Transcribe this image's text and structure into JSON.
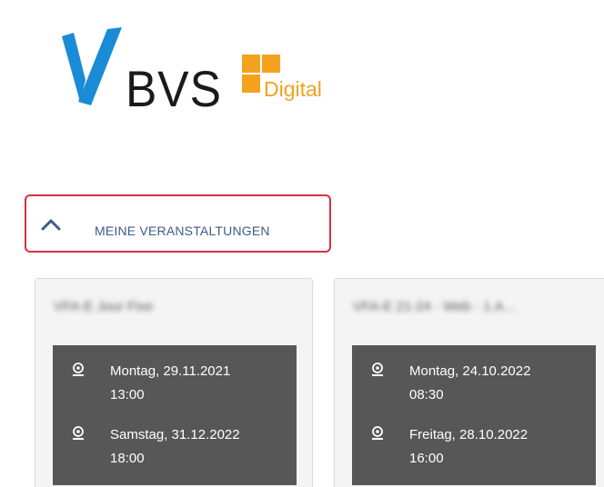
{
  "logo": {
    "wordmark": "BVS",
    "sub_brand": "Digital",
    "colors": {
      "mark": "#1a8bd6",
      "text": "#1a1a1a",
      "accent": "#f4a21d"
    }
  },
  "events_toggle": {
    "label": "MEINE VERANSTALTUNGEN",
    "icon": "chevron-up-icon",
    "border_color": "#d9303e",
    "expanded": true
  },
  "events": [
    {
      "title": "VFA-E Jour Fixe",
      "title_blurred": true,
      "dates": [
        {
          "icon": "webcam-icon",
          "day": "Montag, 29.11.2021",
          "time": "13:00"
        },
        {
          "icon": "webcam-icon",
          "day": "Samstag, 31.12.2022",
          "time": "18:00"
        }
      ]
    },
    {
      "title": "VFA-E 21-24 · Web · 1.A…",
      "title_blurred": true,
      "dates": [
        {
          "icon": "webcam-icon",
          "day": "Montag, 24.10.2022",
          "time": "08:30"
        },
        {
          "icon": "webcam-icon",
          "day": "Freitag, 28.10.2022",
          "time": "16:00"
        }
      ]
    }
  ]
}
